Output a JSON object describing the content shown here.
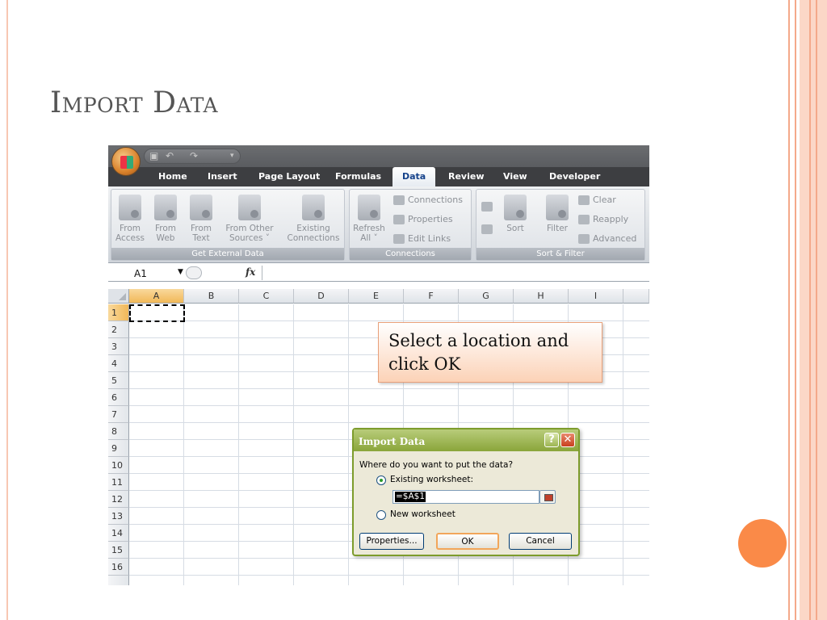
{
  "slide": {
    "title": "Import Data"
  },
  "excel": {
    "tabs": [
      "Home",
      "Insert",
      "Page Layout",
      "Formulas",
      "Data",
      "Review",
      "View",
      "Developer"
    ],
    "active_tab": "Data",
    "ribbon": {
      "get_external_data": {
        "label": "Get External Data",
        "from_access": [
          "From",
          "Access"
        ],
        "from_web": [
          "From",
          "Web"
        ],
        "from_text": [
          "From",
          "Text"
        ],
        "from_other": [
          "From Other",
          "Sources ˅"
        ],
        "existing": [
          "Existing",
          "Connections"
        ]
      },
      "connections": {
        "label": "Connections",
        "refresh": [
          "Refresh",
          "All ˅"
        ],
        "connections_btn": "Connections",
        "properties_btn": "Properties",
        "edit_links_btn": "Edit Links"
      },
      "sort_filter": {
        "label": "Sort & Filter",
        "sort": "Sort",
        "filter": "Filter",
        "clear": "Clear",
        "reapply": "Reapply",
        "advanced": "Advanced",
        "az": "A\nZ",
        "za": "Z\nA"
      }
    },
    "name_box": "A1",
    "fx_label": "fx",
    "columns": [
      "A",
      "B",
      "C",
      "D",
      "E",
      "F",
      "G",
      "H",
      "I"
    ],
    "rows": [
      "1",
      "2",
      "3",
      "4",
      "5",
      "6",
      "7",
      "8",
      "9",
      "10",
      "11",
      "12",
      "13",
      "14",
      "15",
      "16"
    ]
  },
  "callout": {
    "line1": "Select a location and",
    "line2": "click OK"
  },
  "dialog": {
    "title": "Import Data",
    "help": "?",
    "close": "✕",
    "question": "Where do you want to put the data?",
    "existing_worksheet": "Existing worksheet:",
    "existing_worksheet_selected": true,
    "location_value": "=$A$1",
    "new_worksheet": "New worksheet",
    "properties_button": "Properties...",
    "ok_button": "OK",
    "cancel_button": "Cancel"
  },
  "colors": {
    "accent_orange": "#fa8a48",
    "dialog_green": "#8aa53a",
    "title_gray": "#555555"
  }
}
